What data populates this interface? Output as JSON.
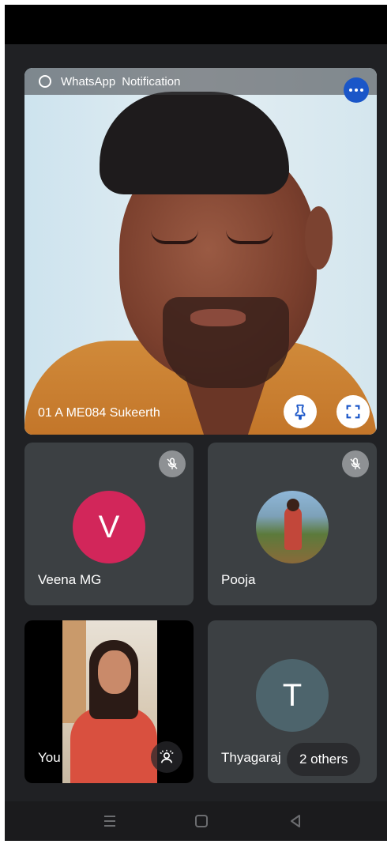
{
  "notification": {
    "app": "WhatsApp",
    "label": "Notification",
    "icon": "whatsapp-icon"
  },
  "main_tile": {
    "participant_name": "01 A ME084 Sukeerth",
    "pin_icon": "pin-icon",
    "fullscreen_icon": "fullscreen-icon"
  },
  "tiles": [
    {
      "name": "Veena MG",
      "avatar_letter": "V",
      "avatar_color": "#d2265a",
      "muted": true
    },
    {
      "name": "Pooja",
      "avatar": "photo",
      "muted": true
    }
  ],
  "self_tile": {
    "name": "You"
  },
  "others_tile": {
    "name": "Thyagaraj",
    "avatar_letter": "T",
    "avatar_color": "#4d646c",
    "others_label": "2 others"
  },
  "colors": {
    "background": "#202124",
    "tile": "#3c4043",
    "accent_blue": "#1a56c8"
  }
}
